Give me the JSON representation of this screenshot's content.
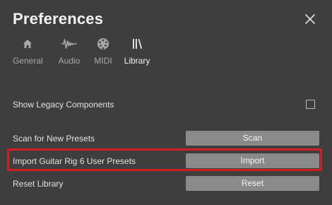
{
  "dialog": {
    "title": "Preferences",
    "close_icon": "close-icon"
  },
  "tabs": [
    {
      "label": "General",
      "icon": "home-icon",
      "active": false
    },
    {
      "label": "Audio",
      "icon": "waveform-icon",
      "active": false
    },
    {
      "label": "MIDI",
      "icon": "midi-connector-icon",
      "active": false
    },
    {
      "label": "Library",
      "icon": "library-icon",
      "active": true
    }
  ],
  "library": {
    "legacy_label": "Show Legacy Components",
    "legacy_checked": false,
    "scan_label": "Scan for New Presets",
    "scan_button": "Scan",
    "import_label": "Import Guitar Rig 6 User Presets",
    "import_button": "Import",
    "reset_label": "Reset Library",
    "reset_button": "Reset"
  },
  "colors": {
    "background": "#3e3e3e",
    "button": "#8a8a8a",
    "highlight": "#d21d24"
  }
}
